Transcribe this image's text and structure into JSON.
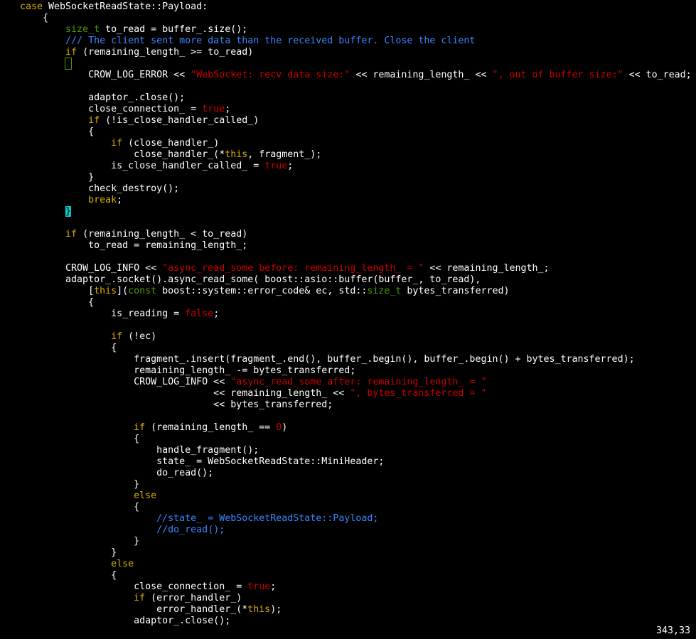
{
  "editor": {
    "lines": [
      [
        {
          "t": "case",
          "c": "kw"
        },
        {
          "t": " WebSocketReadState::Payload:",
          "c": ""
        }
      ],
      [
        {
          "t": "    {",
          "c": ""
        }
      ],
      [
        {
          "t": "        ",
          "c": ""
        },
        {
          "t": "size_t",
          "c": "ty"
        },
        {
          "t": " to_read = buffer_.size();",
          "c": ""
        }
      ],
      [
        {
          "t": "        ",
          "c": ""
        },
        {
          "t": "/// The client sent more data than the received buffer. Close the client",
          "c": "cm"
        }
      ],
      [
        {
          "t": "        ",
          "c": ""
        },
        {
          "t": "if",
          "c": "kw"
        },
        {
          "t": " (remaining_length_ >= to_read)",
          "c": ""
        }
      ],
      [
        {
          "t": "        ",
          "c": ""
        },
        {
          "t": "{",
          "c": "pen"
        }
      ],
      [
        {
          "t": "            CROW_LOG_ERROR << ",
          "c": ""
        },
        {
          "t": "\"WebSocket: recv data size:\"",
          "c": "str"
        },
        {
          "t": " << remaining_length_ << ",
          "c": ""
        },
        {
          "t": "\", out of buffer size:\"",
          "c": "str"
        },
        {
          "t": " << to_read;",
          "c": ""
        }
      ],
      [
        {
          "t": "",
          "c": ""
        }
      ],
      [
        {
          "t": "            adaptor_.close();",
          "c": ""
        }
      ],
      [
        {
          "t": "            close_connection_ = ",
          "c": ""
        },
        {
          "t": "true",
          "c": "num"
        },
        {
          "t": ";",
          "c": ""
        }
      ],
      [
        {
          "t": "            ",
          "c": ""
        },
        {
          "t": "if",
          "c": "kw"
        },
        {
          "t": " (!is_close_handler_called_)",
          "c": ""
        }
      ],
      [
        {
          "t": "            {",
          "c": ""
        }
      ],
      [
        {
          "t": "                ",
          "c": ""
        },
        {
          "t": "if",
          "c": "kw"
        },
        {
          "t": " (close_handler_)",
          "c": ""
        }
      ],
      [
        {
          "t": "                    close_handler_(*",
          "c": ""
        },
        {
          "t": "this",
          "c": "kw"
        },
        {
          "t": ", fragment_);",
          "c": ""
        }
      ],
      [
        {
          "t": "                is_close_handler_called_ = ",
          "c": ""
        },
        {
          "t": "true",
          "c": "num"
        },
        {
          "t": ";",
          "c": ""
        }
      ],
      [
        {
          "t": "            }",
          "c": ""
        }
      ],
      [
        {
          "t": "            check_destroy();",
          "c": ""
        }
      ],
      [
        {
          "t": "            ",
          "c": ""
        },
        {
          "t": "break",
          "c": "kw"
        },
        {
          "t": ";",
          "c": ""
        }
      ],
      [
        {
          "t": "        ",
          "c": ""
        },
        {
          "t": "}",
          "c": "cur"
        }
      ],
      [
        {
          "t": "",
          "c": ""
        }
      ],
      [
        {
          "t": "        ",
          "c": ""
        },
        {
          "t": "if",
          "c": "kw"
        },
        {
          "t": " (remaining_length_ < to_read)",
          "c": ""
        }
      ],
      [
        {
          "t": "            to_read = remaining_length_;",
          "c": ""
        }
      ],
      [
        {
          "t": "",
          "c": ""
        }
      ],
      [
        {
          "t": "        CROW_LOG_INFO << ",
          "c": ""
        },
        {
          "t": "\"async_read_some before: remaining_length_ = \"",
          "c": "str"
        },
        {
          "t": " << remaining_length_;",
          "c": ""
        }
      ],
      [
        {
          "t": "        adaptor_.socket().async_read_some( boost::asio::buffer(buffer_, to_read),",
          "c": ""
        }
      ],
      [
        {
          "t": "            [",
          "c": ""
        },
        {
          "t": "this",
          "c": "kw"
        },
        {
          "t": "](",
          "c": ""
        },
        {
          "t": "const",
          "c": "ty"
        },
        {
          "t": " boost::system::error_code& ec, std::",
          "c": ""
        },
        {
          "t": "size_t",
          "c": "ty"
        },
        {
          "t": " bytes_transferred)",
          "c": ""
        }
      ],
      [
        {
          "t": "            {",
          "c": ""
        }
      ],
      [
        {
          "t": "                is_reading = ",
          "c": ""
        },
        {
          "t": "false",
          "c": "num"
        },
        {
          "t": ";",
          "c": ""
        }
      ],
      [
        {
          "t": "",
          "c": ""
        }
      ],
      [
        {
          "t": "                ",
          "c": ""
        },
        {
          "t": "if",
          "c": "kw"
        },
        {
          "t": " (!ec)",
          "c": ""
        }
      ],
      [
        {
          "t": "                {",
          "c": ""
        }
      ],
      [
        {
          "t": "                    fragment_.insert(fragment_.end(), buffer_.begin(), buffer_.begin() + bytes_transferred);",
          "c": ""
        }
      ],
      [
        {
          "t": "                    remaining_length_ -= bytes_transferred;",
          "c": ""
        }
      ],
      [
        {
          "t": "                    CROW_LOG_INFO << ",
          "c": ""
        },
        {
          "t": "\"async_read_some after: remaining_length_ = \"",
          "c": "str"
        }
      ],
      [
        {
          "t": "                                  << remaining_length_ << ",
          "c": ""
        },
        {
          "t": "\", bytes_transferred = \"",
          "c": "str"
        }
      ],
      [
        {
          "t": "                                  << bytes_transferred;",
          "c": ""
        }
      ],
      [
        {
          "t": "",
          "c": ""
        }
      ],
      [
        {
          "t": "                    ",
          "c": ""
        },
        {
          "t": "if",
          "c": "kw"
        },
        {
          "t": " (remaining_length_ == ",
          "c": ""
        },
        {
          "t": "0",
          "c": "num"
        },
        {
          "t": ")",
          "c": ""
        }
      ],
      [
        {
          "t": "                    {",
          "c": ""
        }
      ],
      [
        {
          "t": "                        handle_fragment();",
          "c": ""
        }
      ],
      [
        {
          "t": "                        state_ = WebSocketReadState::MiniHeader;",
          "c": ""
        }
      ],
      [
        {
          "t": "                        do_read();",
          "c": ""
        }
      ],
      [
        {
          "t": "                    }",
          "c": ""
        }
      ],
      [
        {
          "t": "                    ",
          "c": ""
        },
        {
          "t": "else",
          "c": "kw"
        }
      ],
      [
        {
          "t": "                    {",
          "c": ""
        }
      ],
      [
        {
          "t": "                        ",
          "c": ""
        },
        {
          "t": "//state_ = WebSocketReadState::Payload;",
          "c": "cm"
        }
      ],
      [
        {
          "t": "                        ",
          "c": ""
        },
        {
          "t": "//do_read();",
          "c": "cm"
        }
      ],
      [
        {
          "t": "                    }",
          "c": ""
        }
      ],
      [
        {
          "t": "                }",
          "c": ""
        }
      ],
      [
        {
          "t": "                ",
          "c": ""
        },
        {
          "t": "else",
          "c": "kw"
        }
      ],
      [
        {
          "t": "                {",
          "c": ""
        }
      ],
      [
        {
          "t": "                    close_connection_ = ",
          "c": ""
        },
        {
          "t": "true",
          "c": "num"
        },
        {
          "t": ";",
          "c": ""
        }
      ],
      [
        {
          "t": "                    ",
          "c": ""
        },
        {
          "t": "if",
          "c": "kw"
        },
        {
          "t": " (error_handler_)",
          "c": ""
        }
      ],
      [
        {
          "t": "                        error_handler_(*",
          "c": ""
        },
        {
          "t": "this",
          "c": "kw"
        },
        {
          "t": ");",
          "c": ""
        }
      ],
      [
        {
          "t": "                    adaptor_.close();",
          "c": ""
        }
      ]
    ]
  },
  "status": {
    "position": "343,33"
  },
  "colors": {
    "background": "#000000",
    "text": "#ffffff",
    "keyword": "#d7af00",
    "type": "#4e9a06",
    "string": "#cc0000",
    "comment": "#3a86ff",
    "cursor": "#00cdcd"
  }
}
